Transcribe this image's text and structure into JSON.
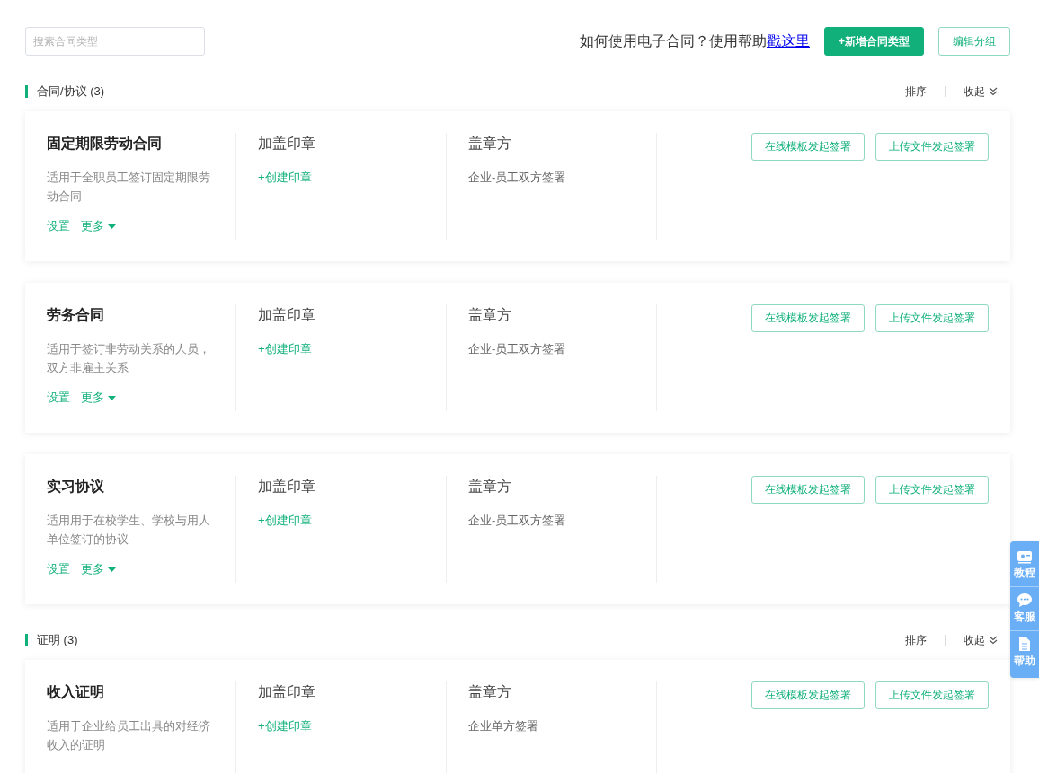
{
  "search": {
    "placeholder": "搜索合同类型"
  },
  "help": {
    "text": "如何使用电子合同？使用帮助",
    "link": "戳这里"
  },
  "toolbar_buttons": [
    {
      "label": "+新增合同类型",
      "kind": "primary"
    },
    {
      "label": "编辑分组",
      "kind": "outline"
    }
  ],
  "sections": [
    {
      "title": "合同/协议",
      "count": "(3)",
      "sort": "排序",
      "collapse": "收起",
      "cards": [
        {
          "title": "固定期限劳动合同",
          "description": "适用于全职员工签订固定期限劳动合同",
          "seal_label": "加盖印章",
          "seal_action": "+创建印章",
          "party_label": "盖章方",
          "party_value": "企业-员工双方签署",
          "links": [
            "设置",
            "更多"
          ],
          "buttons": [
            "在线模板发起签署",
            "上传文件发起签署"
          ]
        },
        {
          "title": "劳务合同",
          "description": "适用于签订非劳动关系的人员，双方非雇主关系",
          "seal_label": "加盖印章",
          "seal_action": "+创建印章",
          "party_label": "盖章方",
          "party_value": "企业-员工双方签署",
          "links": [
            "设置",
            "更多"
          ],
          "buttons": [
            "在线模板发起签署",
            "上传文件发起签署"
          ]
        },
        {
          "title": "实习协议",
          "description": "适用用于在校学生、学校与用人单位签订的协议",
          "seal_label": "加盖印章",
          "seal_action": "+创建印章",
          "party_label": "盖章方",
          "party_value": "企业-员工双方签署",
          "links": [
            "设置",
            "更多"
          ],
          "buttons": [
            "在线模板发起签署",
            "上传文件发起签署"
          ]
        }
      ]
    },
    {
      "title": "证明",
      "count": "(3)",
      "sort": "排序",
      "collapse": "收起",
      "cards": [
        {
          "title": "收入证明",
          "description": "适用于企业给员工出具的对经济收入的证明",
          "seal_label": "加盖印章",
          "seal_action": "+创建印章",
          "party_label": "盖章方",
          "party_value": "企业单方签署",
          "buttons": [
            "在线模板发起签署",
            "上传文件发起签署"
          ]
        }
      ]
    }
  ],
  "side_panel": [
    {
      "label": "教程",
      "kind": "tutorial"
    },
    {
      "label": "客服",
      "kind": "chat"
    },
    {
      "label": "帮助",
      "kind": "doc"
    }
  ]
}
